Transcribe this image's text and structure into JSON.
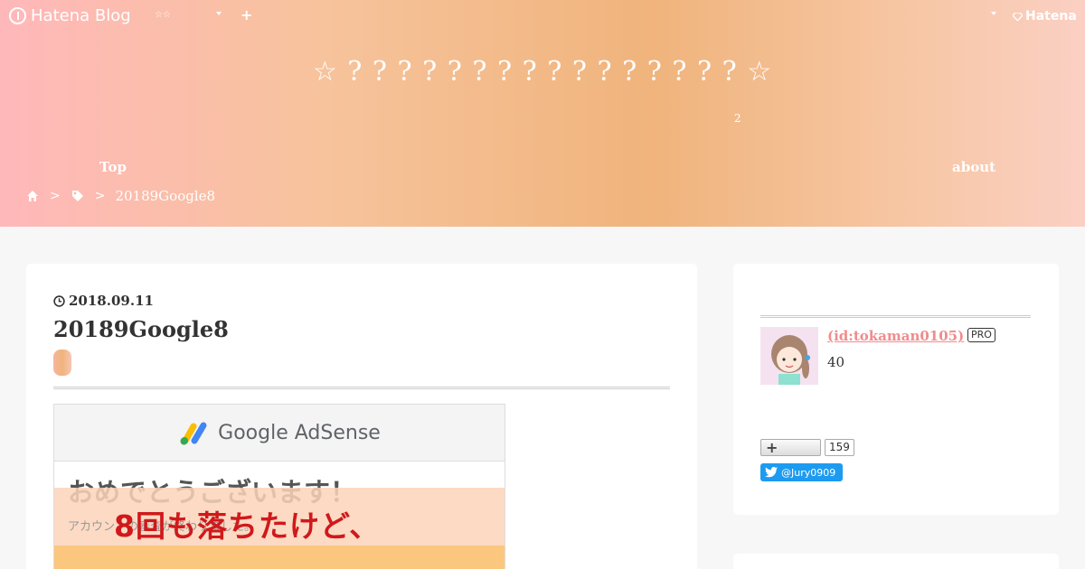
{
  "globalheader": {
    "logo_text": "Hatena Blog",
    "stars": "☆☆",
    "plus": "+",
    "hatena": "Hatena"
  },
  "blog": {
    "title": "☆ ? ? ? ? ? ? ? ? ? ? ? ? ? ? ? ? ☆",
    "description": "2"
  },
  "nav": {
    "top": "Top",
    "about": "about"
  },
  "breadcrumb": {
    "separator": ">",
    "current": "20189Google8"
  },
  "entry": {
    "date": "2018.09.11",
    "title": "20189Google8",
    "image": {
      "brand": "Google AdSense",
      "congrats": "おめでとうございます！",
      "subtext": "アカウントの審査が終わりました。",
      "overlay": "8回も落ちたけど、"
    }
  },
  "sidebar": {
    "profile": {
      "id": "(id:tokaman0105)",
      "badge": "PRO",
      "stat": "40"
    },
    "follow": {
      "plus": "+",
      "count": "159"
    },
    "twitter": {
      "handle": "@Jury0909"
    }
  },
  "colors": {
    "header_gradient": [
      "#ffb8ba",
      "#f0b47c",
      "#fbd0c4"
    ],
    "profile_link": "#f08c8c",
    "twitter": "#1d9bf0",
    "overlay_text": "#d0191b"
  }
}
